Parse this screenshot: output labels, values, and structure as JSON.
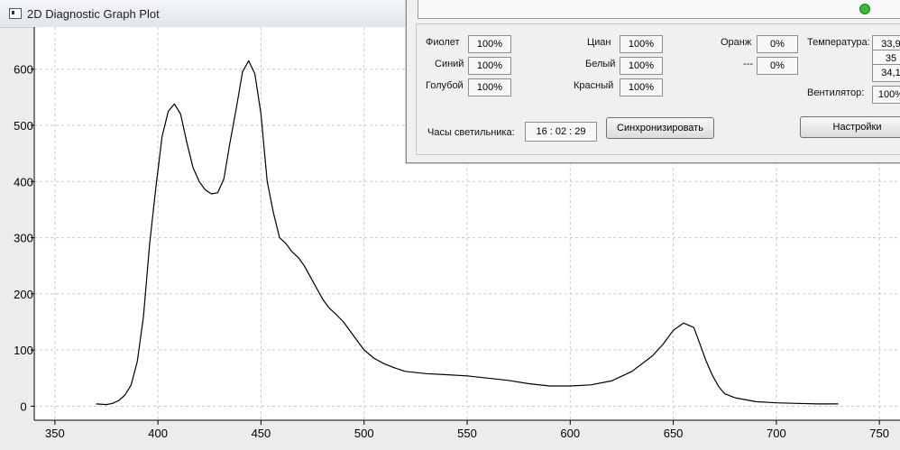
{
  "window": {
    "title": "2D Diagnostic Graph Plot"
  },
  "chart_data": {
    "type": "line",
    "title": "",
    "xlabel": "",
    "ylabel": "",
    "xlim": [
      340,
      760
    ],
    "ylim": [
      -25,
      675
    ],
    "x_ticks": [
      350,
      400,
      450,
      500,
      550,
      600,
      650,
      700,
      750
    ],
    "y_ticks": [
      0,
      100,
      200,
      300,
      400,
      500,
      600
    ],
    "grid": true,
    "series": [
      {
        "x": [
          370,
          375,
          378,
          381,
          384,
          387,
          390,
          393,
          396,
          399,
          402,
          405,
          408,
          411,
          414,
          417,
          420,
          423,
          426,
          429,
          432,
          435,
          438,
          441,
          444,
          447,
          450,
          453,
          456,
          459,
          462,
          465,
          468,
          471,
          474,
          477,
          480,
          483,
          486,
          490,
          495,
          500,
          505,
          510,
          515,
          520,
          530,
          540,
          550,
          560,
          570,
          580,
          590,
          600,
          610,
          620,
          630,
          640,
          645,
          650,
          655,
          660,
          663,
          666,
          669,
          672,
          675,
          680,
          690,
          700,
          710,
          720,
          730
        ],
        "y": [
          4,
          3,
          5,
          10,
          20,
          38,
          80,
          160,
          290,
          390,
          480,
          525,
          538,
          520,
          470,
          425,
          400,
          385,
          378,
          380,
          405,
          470,
          530,
          595,
          615,
          592,
          520,
          400,
          345,
          300,
          290,
          275,
          265,
          250,
          230,
          210,
          190,
          175,
          165,
          150,
          125,
          100,
          85,
          75,
          68,
          62,
          58,
          56,
          54,
          50,
          46,
          40,
          36,
          36,
          38,
          45,
          62,
          90,
          110,
          135,
          148,
          140,
          110,
          80,
          55,
          35,
          22,
          15,
          8,
          6,
          5,
          4,
          4
        ]
      }
    ]
  },
  "panel": {
    "channels": [
      {
        "label": "Фиолет",
        "value": "100%"
      },
      {
        "label": "Синий",
        "value": "100%"
      },
      {
        "label": "Голубой",
        "value": "100%"
      },
      {
        "label": "Циан",
        "value": "100%"
      },
      {
        "label": "Белый",
        "value": "100%"
      },
      {
        "label": "Красный",
        "value": "100%"
      },
      {
        "label": "Оранж",
        "value": "0%"
      },
      {
        "label": "---",
        "value": "0%"
      }
    ],
    "temperature_label": "Температура:",
    "temperatures": [
      "33,9",
      "35",
      "34,1"
    ],
    "fan_label": "Вентилятор:",
    "fan_value": "100%",
    "clock_label": "Часы светильника:",
    "clock_value": "16 : 02 : 29",
    "sync_button": "Синхронизировать",
    "settings_button": "Настройки"
  }
}
